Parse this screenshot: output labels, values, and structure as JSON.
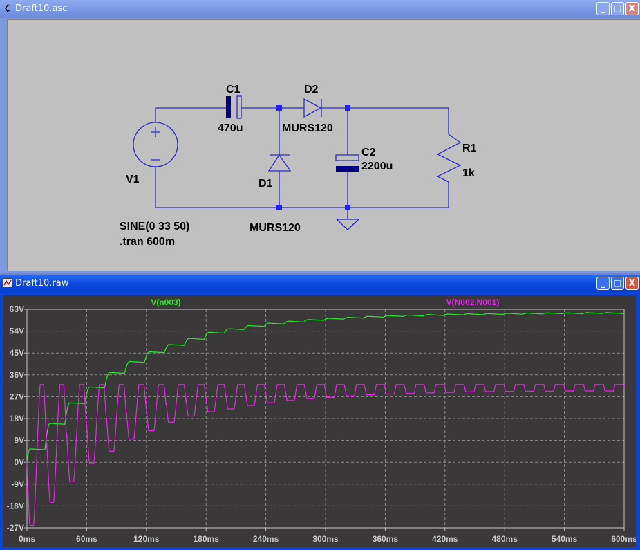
{
  "schematic_window": {
    "title": "Draft10.asc",
    "icon": "ltspice-schematic-icon",
    "components": {
      "c1_name": "C1",
      "c1_value": "470u",
      "d2_name": "D2",
      "d2_model": "MURS120",
      "c2_name": "C2",
      "c2_value": "2200u",
      "r1_name": "R1",
      "r1_value": "1k",
      "v1_name": "V1",
      "v1_value": "SINE(0 33 50)",
      "d1_name": "D1",
      "d1_model": "MURS120",
      "directive": ".tran 600m"
    },
    "wire_color": "#2b2bd0"
  },
  "waveform_window": {
    "title": "Draft10.raw",
    "icon": "waveform-icon"
  },
  "controls": {
    "minimize": "_",
    "maximize": "□",
    "close": "X"
  },
  "chart_data": {
    "type": "line",
    "xlabel": "",
    "ylabel": "",
    "xlim": [
      0,
      600
    ],
    "ylim": [
      -27,
      63
    ],
    "x_unit": "ms",
    "x_ticks": [
      "0ms",
      "60ms",
      "120ms",
      "180ms",
      "240ms",
      "300ms",
      "360ms",
      "420ms",
      "480ms",
      "540ms",
      "600ms"
    ],
    "y_ticks": [
      "63V",
      "54V",
      "45V",
      "36V",
      "27V",
      "18V",
      "9V",
      "0V",
      "-9V",
      "-18V",
      "-27V"
    ],
    "grid": true,
    "background": "#3a3838",
    "period_ms": 20,
    "series": [
      {
        "name": "V(n003)",
        "color": "#22ee22",
        "description_of_values": "plateau voltage after each source cycle",
        "cycle_levels": [
          5.5,
          16,
          24.5,
          31,
          37,
          41.5,
          45.5,
          48.5,
          51,
          53.5,
          55,
          56.3,
          57.3,
          58.1,
          58.8,
          59.3,
          59.7,
          60.1,
          60.4,
          60.6,
          60.8,
          61,
          61.1,
          61.2,
          61.3,
          61.4,
          61.5,
          61.5,
          61.6,
          61.6
        ]
      },
      {
        "name": "V(N002,N001)",
        "color": "#ee22ee",
        "clip_high": 32,
        "cycle_troughs": [
          -26,
          -16.5,
          -8,
          -0.5,
          4.5,
          9.5,
          13,
          16.5,
          19,
          20.8,
          22,
          23.4,
          24.5,
          25.4,
          26.2,
          26.7,
          27.3,
          27.8,
          28.1,
          28.4,
          28.6,
          28.8,
          29,
          29.1,
          29.2,
          29.3,
          29.3,
          29.4,
          29.4,
          29.4
        ]
      }
    ]
  }
}
